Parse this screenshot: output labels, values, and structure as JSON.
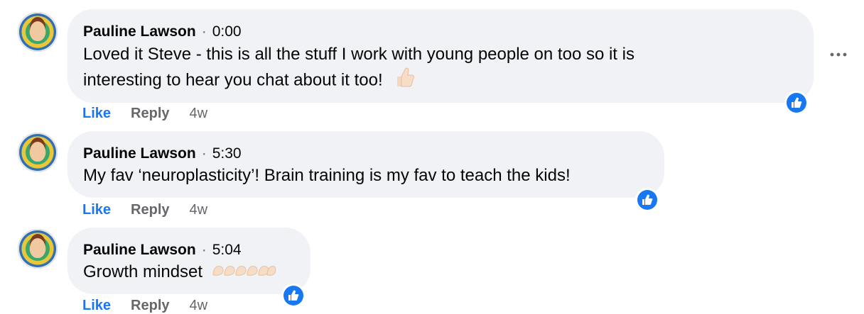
{
  "comments": [
    {
      "author": "Pauline Lawson",
      "separator": "·",
      "timestamp": "0:00",
      "line1": "Loved it Steve - this is all the stuff I work with young people on too so it is",
      "line2": "interesting to hear you chat about it too!",
      "emoji": "thumbs-up-icon",
      "actions": {
        "like": "Like",
        "reply": "Reply",
        "age": "4w"
      }
    },
    {
      "author": "Pauline Lawson",
      "separator": "·",
      "timestamp": "5:30",
      "line1": "My fav ‘neuroplasticity’! Brain training is my fav to teach the kids!",
      "actions": {
        "like": "Like",
        "reply": "Reply",
        "age": "4w"
      }
    },
    {
      "author": "Pauline Lawson",
      "separator": "·",
      "timestamp": "5:04",
      "line1": "Growth mindset",
      "emoji": "flexed-arms-icon",
      "actions": {
        "like": "Like",
        "reply": "Reply",
        "age": "4w"
      }
    }
  ],
  "colors": {
    "accent": "#1877f2",
    "bubble": "#f0f2f5",
    "muted": "#65676b"
  },
  "icons": {
    "more": "more-options-icon",
    "reaction": "like-reaction-icon",
    "avatar": "avatar"
  }
}
